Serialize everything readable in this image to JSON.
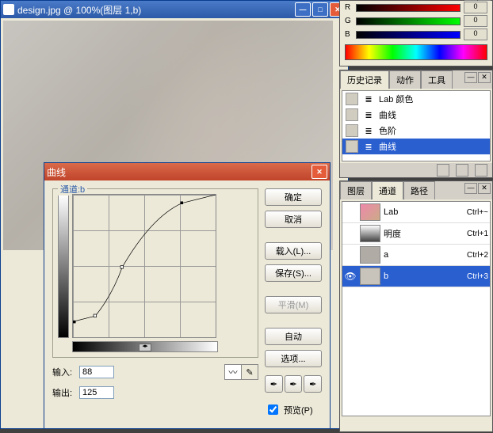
{
  "imgwin": {
    "title": "design.jpg @ 100%(图层 1,b)"
  },
  "curves": {
    "title": "曲线",
    "channel_label": "通道:b",
    "input_label": "输入:",
    "output_label": "输出:",
    "input_value": "88",
    "output_value": "125",
    "buttons": {
      "ok": "确定",
      "cancel": "取消",
      "load": "载入(L)...",
      "save": "保存(S)...",
      "smooth": "平滑(M)",
      "auto": "自动",
      "options": "选项..."
    },
    "preview_label": "预览(P)"
  },
  "color": {
    "r": "R",
    "g": "G",
    "b": "B",
    "rv": "0",
    "gv": "0",
    "bv": "0"
  },
  "history": {
    "tabs": [
      "历史记录",
      "动作",
      "工具"
    ],
    "items": [
      {
        "label": "Lab 颜色"
      },
      {
        "label": "曲线"
      },
      {
        "label": "色阶"
      },
      {
        "label": "曲线",
        "sel": true
      }
    ]
  },
  "layers": {
    "tabs": [
      "图层",
      "通道",
      "路径"
    ],
    "items": [
      {
        "name": "Lab",
        "sc": "Ctrl+~",
        "cls": "lab"
      },
      {
        "name": "明度",
        "sc": "Ctrl+1",
        "cls": "lum"
      },
      {
        "name": "a",
        "sc": "Ctrl+2",
        "cls": "a"
      },
      {
        "name": "b",
        "sc": "Ctrl+3",
        "cls": "b",
        "sel": true,
        "eye": true
      }
    ]
  },
  "chart_data": {
    "type": "line",
    "title": "Curves: channel b",
    "xlabel": "Input",
    "ylabel": "Output",
    "xlim": [
      0,
      255
    ],
    "ylim": [
      0,
      255
    ],
    "series": [
      {
        "name": "curve",
        "x": [
          0,
          40,
          88,
          195,
          255
        ],
        "y": [
          28,
          38,
          125,
          240,
          255
        ]
      }
    ],
    "points_marked": [
      {
        "x": 88,
        "y": 125
      }
    ]
  }
}
